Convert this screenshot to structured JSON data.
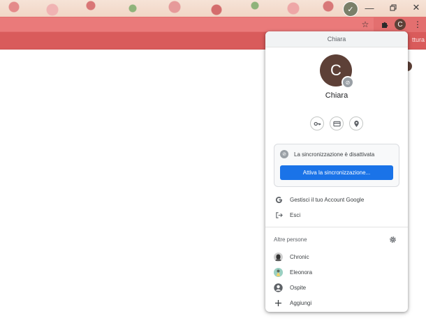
{
  "browser": {
    "bookmark_tail": "ttura",
    "profile_initial": "C"
  },
  "popup": {
    "header": "Chiara",
    "avatar_initial": "C",
    "name": "Chiara",
    "quick_actions": [
      "key-icon",
      "credit-card-icon",
      "location-pin-icon"
    ],
    "sync_status": "La sincronizzazione è disattivata",
    "sync_button": "Attiva la sincronizzazione...",
    "manage_account": "Gestisci il tuo Account Google",
    "sign_out": "Esci",
    "other_people_title": "Altre persone",
    "people": [
      {
        "label": "Chronic",
        "icon": "chronic-avatar"
      },
      {
        "label": "Eleonora",
        "icon": "eleonora-avatar"
      },
      {
        "label": "Ospite",
        "icon": "guest-icon"
      },
      {
        "label": "Aggiungi",
        "icon": "plus-icon"
      }
    ]
  },
  "colors": {
    "toolbar": "#e36f6f",
    "bookmarks_bar": "#d95b5b",
    "avatar": "#5d4037",
    "sync_button": "#1a73e8"
  }
}
